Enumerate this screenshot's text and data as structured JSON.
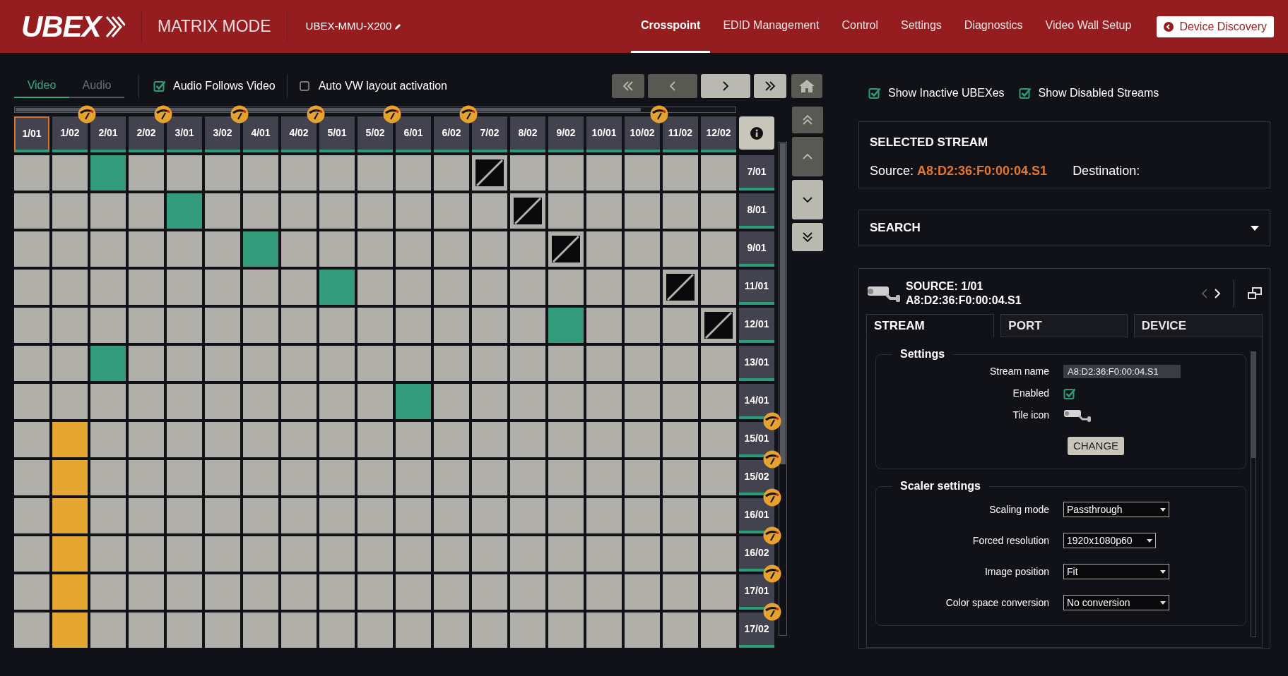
{
  "header": {
    "logo": "UBEX",
    "mode": "MATRIX MODE",
    "device": "UBEX-MMU-X200",
    "nav": [
      {
        "label": "Crosspoint",
        "selected": true
      },
      {
        "label": "EDID Management",
        "selected": false
      },
      {
        "label": "Control",
        "selected": false
      },
      {
        "label": "Settings",
        "selected": false
      },
      {
        "label": "Diagnostics",
        "selected": false
      },
      {
        "label": "Video Wall Setup",
        "selected": false
      }
    ],
    "discovery_button": "Device Discovery"
  },
  "toolbar": {
    "tabs": [
      {
        "label": "Video",
        "selected": true
      },
      {
        "label": "Audio",
        "selected": false
      }
    ],
    "options": [
      {
        "label": "Audio Follows Video",
        "checked": true
      },
      {
        "label": "Auto VW layout activation",
        "checked": false
      }
    ]
  },
  "matrix": {
    "columns": [
      {
        "label": "1/01",
        "selected": true,
        "badge": false
      },
      {
        "label": "1/02",
        "selected": false,
        "badge": true
      },
      {
        "label": "2/01",
        "selected": false,
        "badge": false
      },
      {
        "label": "2/02",
        "selected": false,
        "badge": true
      },
      {
        "label": "3/01",
        "selected": false,
        "badge": false
      },
      {
        "label": "3/02",
        "selected": false,
        "badge": true
      },
      {
        "label": "4/01",
        "selected": false,
        "badge": false
      },
      {
        "label": "4/02",
        "selected": false,
        "badge": true
      },
      {
        "label": "5/01",
        "selected": false,
        "badge": false
      },
      {
        "label": "5/02",
        "selected": false,
        "badge": true
      },
      {
        "label": "6/01",
        "selected": false,
        "badge": false
      },
      {
        "label": "6/02",
        "selected": false,
        "badge": true
      },
      {
        "label": "7/02",
        "selected": false,
        "badge": false
      },
      {
        "label": "8/02",
        "selected": false,
        "badge": false
      },
      {
        "label": "9/02",
        "selected": false,
        "badge": false
      },
      {
        "label": "10/01",
        "selected": false,
        "badge": false
      },
      {
        "label": "10/02",
        "selected": false,
        "badge": true
      },
      {
        "label": "11/02",
        "selected": false,
        "badge": false
      },
      {
        "label": "12/02",
        "selected": false,
        "badge": false
      }
    ],
    "rows": [
      {
        "label": "7/01",
        "badge": false,
        "cells": [
          {
            "kind": "off"
          },
          {
            "kind": "off"
          },
          {
            "kind": "on"
          },
          {
            "kind": "off"
          },
          {
            "kind": "off"
          },
          {
            "kind": "off"
          },
          {
            "kind": "off"
          },
          {
            "kind": "off"
          },
          {
            "kind": "off"
          },
          {
            "kind": "off"
          },
          {
            "kind": "off"
          },
          {
            "kind": "off"
          },
          {
            "kind": "blocked"
          },
          {
            "kind": "off"
          },
          {
            "kind": "off"
          },
          {
            "kind": "off"
          },
          {
            "kind": "off"
          },
          {
            "kind": "off"
          },
          {
            "kind": "off"
          }
        ]
      },
      {
        "label": "8/01",
        "badge": false,
        "cells": [
          {
            "kind": "off"
          },
          {
            "kind": "off"
          },
          {
            "kind": "off"
          },
          {
            "kind": "off"
          },
          {
            "kind": "on"
          },
          {
            "kind": "off"
          },
          {
            "kind": "off"
          },
          {
            "kind": "off"
          },
          {
            "kind": "off"
          },
          {
            "kind": "off"
          },
          {
            "kind": "off"
          },
          {
            "kind": "off"
          },
          {
            "kind": "off"
          },
          {
            "kind": "blocked"
          },
          {
            "kind": "off"
          },
          {
            "kind": "off"
          },
          {
            "kind": "off"
          },
          {
            "kind": "off"
          },
          {
            "kind": "off"
          }
        ]
      },
      {
        "label": "9/01",
        "badge": false,
        "cells": [
          {
            "kind": "off"
          },
          {
            "kind": "off"
          },
          {
            "kind": "off"
          },
          {
            "kind": "off"
          },
          {
            "kind": "off"
          },
          {
            "kind": "off"
          },
          {
            "kind": "on"
          },
          {
            "kind": "off"
          },
          {
            "kind": "off"
          },
          {
            "kind": "off"
          },
          {
            "kind": "off"
          },
          {
            "kind": "off"
          },
          {
            "kind": "off"
          },
          {
            "kind": "off"
          },
          {
            "kind": "blocked"
          },
          {
            "kind": "off"
          },
          {
            "kind": "off"
          },
          {
            "kind": "off"
          },
          {
            "kind": "off"
          }
        ]
      },
      {
        "label": "11/01",
        "badge": false,
        "cells": [
          {
            "kind": "off"
          },
          {
            "kind": "off"
          },
          {
            "kind": "off"
          },
          {
            "kind": "off"
          },
          {
            "kind": "off"
          },
          {
            "kind": "off"
          },
          {
            "kind": "off"
          },
          {
            "kind": "off"
          },
          {
            "kind": "on"
          },
          {
            "kind": "off"
          },
          {
            "kind": "off"
          },
          {
            "kind": "off"
          },
          {
            "kind": "off"
          },
          {
            "kind": "off"
          },
          {
            "kind": "off"
          },
          {
            "kind": "off"
          },
          {
            "kind": "off"
          },
          {
            "kind": "blocked"
          },
          {
            "kind": "off"
          }
        ]
      },
      {
        "label": "12/01",
        "badge": false,
        "cells": [
          {
            "kind": "off"
          },
          {
            "kind": "off"
          },
          {
            "kind": "off"
          },
          {
            "kind": "off"
          },
          {
            "kind": "off"
          },
          {
            "kind": "off"
          },
          {
            "kind": "off"
          },
          {
            "kind": "off"
          },
          {
            "kind": "off"
          },
          {
            "kind": "off"
          },
          {
            "kind": "off"
          },
          {
            "kind": "off"
          },
          {
            "kind": "off"
          },
          {
            "kind": "off"
          },
          {
            "kind": "on"
          },
          {
            "kind": "off"
          },
          {
            "kind": "off"
          },
          {
            "kind": "off"
          },
          {
            "kind": "blocked"
          }
        ]
      },
      {
        "label": "13/01",
        "badge": false,
        "cells": [
          {
            "kind": "off"
          },
          {
            "kind": "off"
          },
          {
            "kind": "on"
          },
          {
            "kind": "off"
          },
          {
            "kind": "off"
          },
          {
            "kind": "off"
          },
          {
            "kind": "off"
          },
          {
            "kind": "off"
          },
          {
            "kind": "off"
          },
          {
            "kind": "off"
          },
          {
            "kind": "off"
          },
          {
            "kind": "off"
          },
          {
            "kind": "off"
          },
          {
            "kind": "off"
          },
          {
            "kind": "off"
          },
          {
            "kind": "off"
          },
          {
            "kind": "off"
          },
          {
            "kind": "off"
          },
          {
            "kind": "off"
          }
        ]
      },
      {
        "label": "14/01",
        "badge": false,
        "cells": [
          {
            "kind": "off"
          },
          {
            "kind": "off"
          },
          {
            "kind": "off"
          },
          {
            "kind": "off"
          },
          {
            "kind": "off"
          },
          {
            "kind": "off"
          },
          {
            "kind": "off"
          },
          {
            "kind": "off"
          },
          {
            "kind": "off"
          },
          {
            "kind": "off"
          },
          {
            "kind": "on"
          },
          {
            "kind": "off"
          },
          {
            "kind": "off"
          },
          {
            "kind": "off"
          },
          {
            "kind": "off"
          },
          {
            "kind": "off"
          },
          {
            "kind": "off"
          },
          {
            "kind": "off"
          },
          {
            "kind": "off"
          }
        ]
      },
      {
        "label": "15/01",
        "badge": true,
        "cells": [
          {
            "kind": "off"
          },
          {
            "kind": "warn"
          },
          {
            "kind": "off"
          },
          {
            "kind": "off"
          },
          {
            "kind": "off"
          },
          {
            "kind": "off"
          },
          {
            "kind": "off"
          },
          {
            "kind": "off"
          },
          {
            "kind": "off"
          },
          {
            "kind": "off"
          },
          {
            "kind": "off"
          },
          {
            "kind": "off"
          },
          {
            "kind": "off"
          },
          {
            "kind": "off"
          },
          {
            "kind": "off"
          },
          {
            "kind": "off"
          },
          {
            "kind": "off"
          },
          {
            "kind": "off"
          },
          {
            "kind": "off"
          }
        ]
      },
      {
        "label": "15/02",
        "badge": true,
        "cells": [
          {
            "kind": "off"
          },
          {
            "kind": "warn"
          },
          {
            "kind": "off"
          },
          {
            "kind": "off"
          },
          {
            "kind": "off"
          },
          {
            "kind": "off"
          },
          {
            "kind": "off"
          },
          {
            "kind": "off"
          },
          {
            "kind": "off"
          },
          {
            "kind": "off"
          },
          {
            "kind": "off"
          },
          {
            "kind": "off"
          },
          {
            "kind": "off"
          },
          {
            "kind": "off"
          },
          {
            "kind": "off"
          },
          {
            "kind": "off"
          },
          {
            "kind": "off"
          },
          {
            "kind": "off"
          },
          {
            "kind": "off"
          }
        ]
      },
      {
        "label": "16/01",
        "badge": true,
        "cells": [
          {
            "kind": "off"
          },
          {
            "kind": "warn"
          },
          {
            "kind": "off"
          },
          {
            "kind": "off"
          },
          {
            "kind": "off"
          },
          {
            "kind": "off"
          },
          {
            "kind": "off"
          },
          {
            "kind": "off"
          },
          {
            "kind": "off"
          },
          {
            "kind": "off"
          },
          {
            "kind": "off"
          },
          {
            "kind": "off"
          },
          {
            "kind": "off"
          },
          {
            "kind": "off"
          },
          {
            "kind": "off"
          },
          {
            "kind": "off"
          },
          {
            "kind": "off"
          },
          {
            "kind": "off"
          },
          {
            "kind": "off"
          }
        ]
      },
      {
        "label": "16/02",
        "badge": true,
        "cells": [
          {
            "kind": "off"
          },
          {
            "kind": "warn"
          },
          {
            "kind": "off"
          },
          {
            "kind": "off"
          },
          {
            "kind": "off"
          },
          {
            "kind": "off"
          },
          {
            "kind": "off"
          },
          {
            "kind": "off"
          },
          {
            "kind": "off"
          },
          {
            "kind": "off"
          },
          {
            "kind": "off"
          },
          {
            "kind": "off"
          },
          {
            "kind": "off"
          },
          {
            "kind": "off"
          },
          {
            "kind": "off"
          },
          {
            "kind": "off"
          },
          {
            "kind": "off"
          },
          {
            "kind": "off"
          },
          {
            "kind": "off"
          }
        ]
      },
      {
        "label": "17/01",
        "badge": true,
        "cells": [
          {
            "kind": "off"
          },
          {
            "kind": "warn"
          },
          {
            "kind": "off"
          },
          {
            "kind": "off"
          },
          {
            "kind": "off"
          },
          {
            "kind": "off"
          },
          {
            "kind": "off"
          },
          {
            "kind": "off"
          },
          {
            "kind": "off"
          },
          {
            "kind": "off"
          },
          {
            "kind": "off"
          },
          {
            "kind": "off"
          },
          {
            "kind": "off"
          },
          {
            "kind": "off"
          },
          {
            "kind": "off"
          },
          {
            "kind": "off"
          },
          {
            "kind": "off"
          },
          {
            "kind": "off"
          },
          {
            "kind": "off"
          }
        ]
      },
      {
        "label": "17/02",
        "badge": true,
        "cells": [
          {
            "kind": "off"
          },
          {
            "kind": "warn"
          },
          {
            "kind": "off"
          },
          {
            "kind": "off"
          },
          {
            "kind": "off"
          },
          {
            "kind": "off"
          },
          {
            "kind": "off"
          },
          {
            "kind": "off"
          },
          {
            "kind": "off"
          },
          {
            "kind": "off"
          },
          {
            "kind": "off"
          },
          {
            "kind": "off"
          },
          {
            "kind": "off"
          },
          {
            "kind": "off"
          },
          {
            "kind": "off"
          },
          {
            "kind": "off"
          },
          {
            "kind": "off"
          },
          {
            "kind": "off"
          },
          {
            "kind": "off"
          }
        ]
      }
    ]
  },
  "filters": [
    {
      "label": "Show Inactive UBEXes",
      "checked": true
    },
    {
      "label": "Show Disabled Streams",
      "checked": true
    }
  ],
  "selected_stream": {
    "title": "SELECTED STREAM",
    "source_label": "Source:",
    "source": "A8:D2:36:F0:00:04.S1",
    "destination_label": "Destination:"
  },
  "search": {
    "title": "SEARCH",
    "expanded": false
  },
  "source_panel": {
    "title": "SOURCE: 1/01",
    "address": "A8:D2:36:F0:00:04.S1",
    "tabs": [
      {
        "label": "STREAM",
        "selected": true
      },
      {
        "label": "PORT",
        "selected": false
      },
      {
        "label": "DEVICE",
        "selected": false
      }
    ],
    "settings": {
      "title": "Settings",
      "stream_name_label": "Stream name",
      "stream_name": "A8:D2:36:F0:00:04.S1",
      "enabled_label": "Enabled",
      "enabled": true,
      "tile_icon_label": "Tile icon",
      "change_button": "CHANGE"
    },
    "scaler": {
      "title": "Scaler settings",
      "fields": [
        {
          "label": "Scaling mode",
          "value": "Passthrough"
        },
        {
          "label": "Forced resolution",
          "value": "1920x1080p60"
        },
        {
          "label": "Image position",
          "value": "Fit"
        },
        {
          "label": "Color space conversion",
          "value": "No conversion"
        }
      ]
    }
  }
}
